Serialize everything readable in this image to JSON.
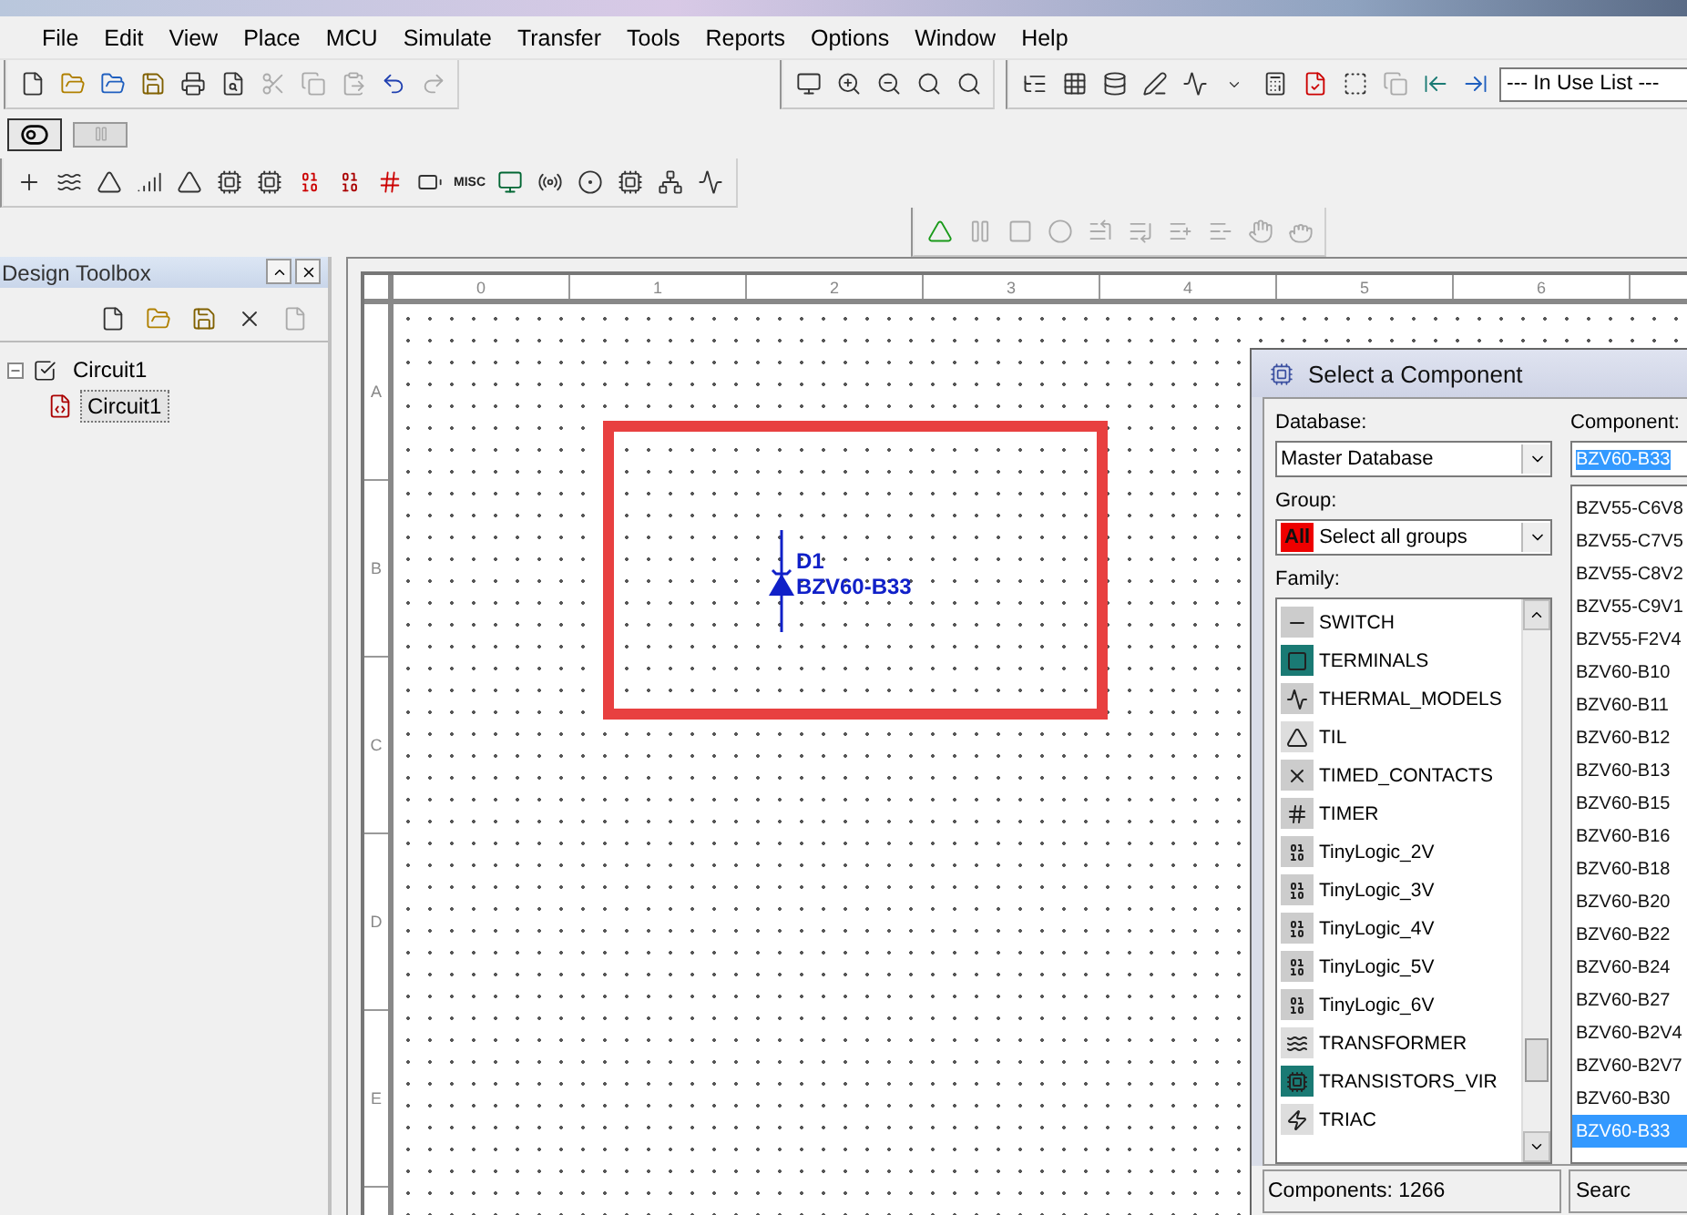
{
  "menu": [
    "File",
    "Edit",
    "View",
    "Place",
    "MCU",
    "Simulate",
    "Transfer",
    "Tools",
    "Reports",
    "Options",
    "Window",
    "Help"
  ],
  "toolbar": {
    "in_use_list": "--- In Use List ---",
    "misc_label": "MISC"
  },
  "design_toolbox": {
    "title": "Design Toolbox",
    "tree": [
      {
        "label": "Circuit1",
        "selected": false,
        "expanded": true,
        "children": [
          {
            "label": "Circuit1",
            "selected": true
          }
        ]
      }
    ]
  },
  "canvas": {
    "ruler_columns": [
      "0",
      "1",
      "2",
      "3",
      "4",
      "5",
      "6"
    ],
    "ruler_rows": [
      "A",
      "B",
      "C",
      "D",
      "E"
    ],
    "component": {
      "ref": "D1",
      "value": "BZV60-B33"
    }
  },
  "dialog": {
    "title": "Select a Component",
    "database_label": "Database:",
    "database": "Master Database",
    "group_label": "Group:",
    "group_badge": "All",
    "group": "Select all groups",
    "family_label": "Family:",
    "families": [
      {
        "label": "SWITCH"
      },
      {
        "label": "TERMINALS"
      },
      {
        "label": "THERMAL_MODELS"
      },
      {
        "label": "TIL"
      },
      {
        "label": "TIMED_CONTACTS"
      },
      {
        "label": "TIMER"
      },
      {
        "label": "TinyLogic_2V"
      },
      {
        "label": "TinyLogic_3V"
      },
      {
        "label": "TinyLogic_4V"
      },
      {
        "label": "TinyLogic_5V"
      },
      {
        "label": "TinyLogic_6V"
      },
      {
        "label": "TRANSFORMER"
      },
      {
        "label": "TRANSISTORS_VIR"
      },
      {
        "label": "TRIAC"
      }
    ],
    "component_label": "Component:",
    "component_value": "BZV60-B33",
    "components": [
      {
        "label": "BZV55-C6V8",
        "selected": false
      },
      {
        "label": "BZV55-C7V5",
        "selected": false
      },
      {
        "label": "BZV55-C8V2",
        "selected": false
      },
      {
        "label": "BZV55-C9V1",
        "selected": false
      },
      {
        "label": "BZV55-F2V4",
        "selected": false
      },
      {
        "label": "BZV60-B10",
        "selected": false
      },
      {
        "label": "BZV60-B11",
        "selected": false
      },
      {
        "label": "BZV60-B12",
        "selected": false
      },
      {
        "label": "BZV60-B13",
        "selected": false
      },
      {
        "label": "BZV60-B15",
        "selected": false
      },
      {
        "label": "BZV60-B16",
        "selected": false
      },
      {
        "label": "BZV60-B18",
        "selected": false
      },
      {
        "label": "BZV60-B20",
        "selected": false
      },
      {
        "label": "BZV60-B22",
        "selected": false
      },
      {
        "label": "BZV60-B24",
        "selected": false
      },
      {
        "label": "BZV60-B27",
        "selected": false
      },
      {
        "label": "BZV60-B2V4",
        "selected": false
      },
      {
        "label": "BZV60-B2V7",
        "selected": false
      },
      {
        "label": "BZV60-B30",
        "selected": false
      },
      {
        "label": "BZV60-B33",
        "selected": true
      }
    ],
    "status": "Components: 1266",
    "search_button": "Searc"
  }
}
